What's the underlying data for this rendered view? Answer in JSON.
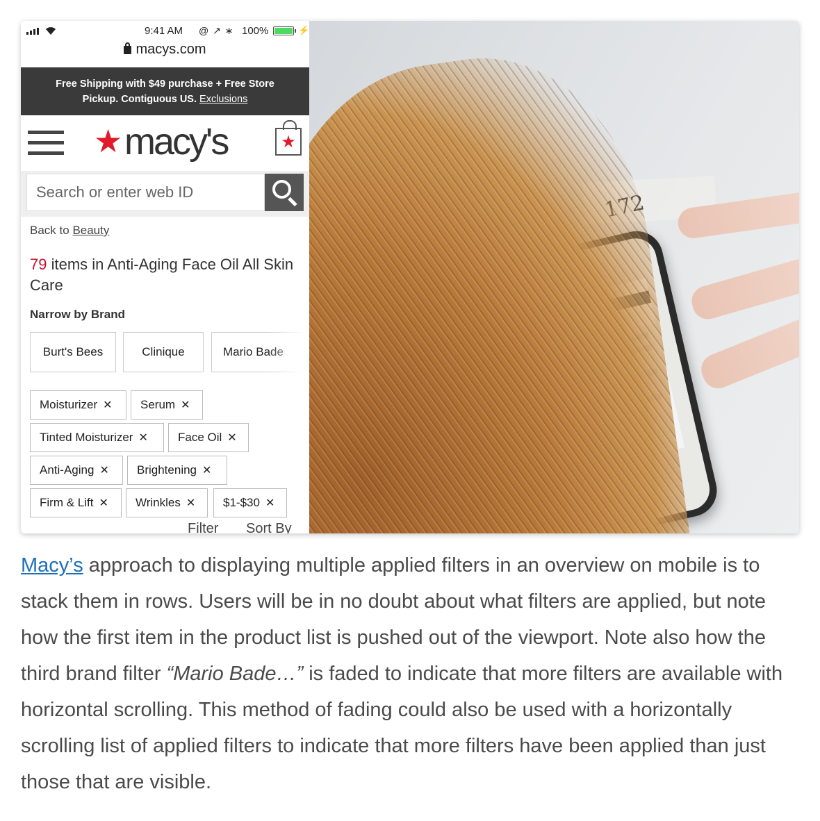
{
  "status_bar": {
    "time": "9:41 AM",
    "icons": "@ ↗ ∗",
    "battery": "100%"
  },
  "url_bar": {
    "domain": "macys.com"
  },
  "promo": {
    "line1": "Free Shipping with $49 purchase + Free Store",
    "line2": "Pickup. Contiguous US.",
    "link": "Exclusions"
  },
  "header": {
    "logo_text": "macy's",
    "logo_star": "★",
    "bag_star": "★"
  },
  "search": {
    "placeholder": "Search or enter web ID"
  },
  "breadcrumb": {
    "prefix": "Back to",
    "link": "Beauty"
  },
  "results": {
    "count": "79",
    "text": " items in Anti-Aging Face Oil All Skin Care"
  },
  "narrow": {
    "heading": "Narrow by Brand",
    "brands": [
      "Burt's Bees",
      "Clinique",
      "Mario Bade"
    ]
  },
  "applied_filters": [
    "Moisturizer",
    "Serum",
    "Tinted Moisturizer",
    "Face Oil",
    "Anti-Aging",
    "Brightening",
    "Firm & Lift",
    "Wrinkles",
    "$1-$30"
  ],
  "remove_glyph": "✕",
  "bottom_tabs": {
    "filter": "Filter",
    "sort": "Sort By"
  },
  "photo": {
    "paper_number": "172"
  },
  "caption": {
    "link": "Macy’s",
    "part1": " approach to displaying multiple applied filters in an overview on mobile is to stack them in rows. Users will be in no doubt about what filters are applied, but note how the first item in the product list is pushed out of the viewport. Note also how the third brand filter ",
    "quoted": "“Mario Bade…”",
    "part2": " is faded to indicate that more filters are available with horizontal scrolling. This method of fading could also be used with a horizontally scrolling list of applied filters to indicate that more filters have been applied than just those that are visible."
  },
  "colors": {
    "brand_red": "#e01a2b",
    "promo_bg": "#3a3a3a",
    "link_blue": "#1d6fb8",
    "count_red": "#c8102e"
  }
}
